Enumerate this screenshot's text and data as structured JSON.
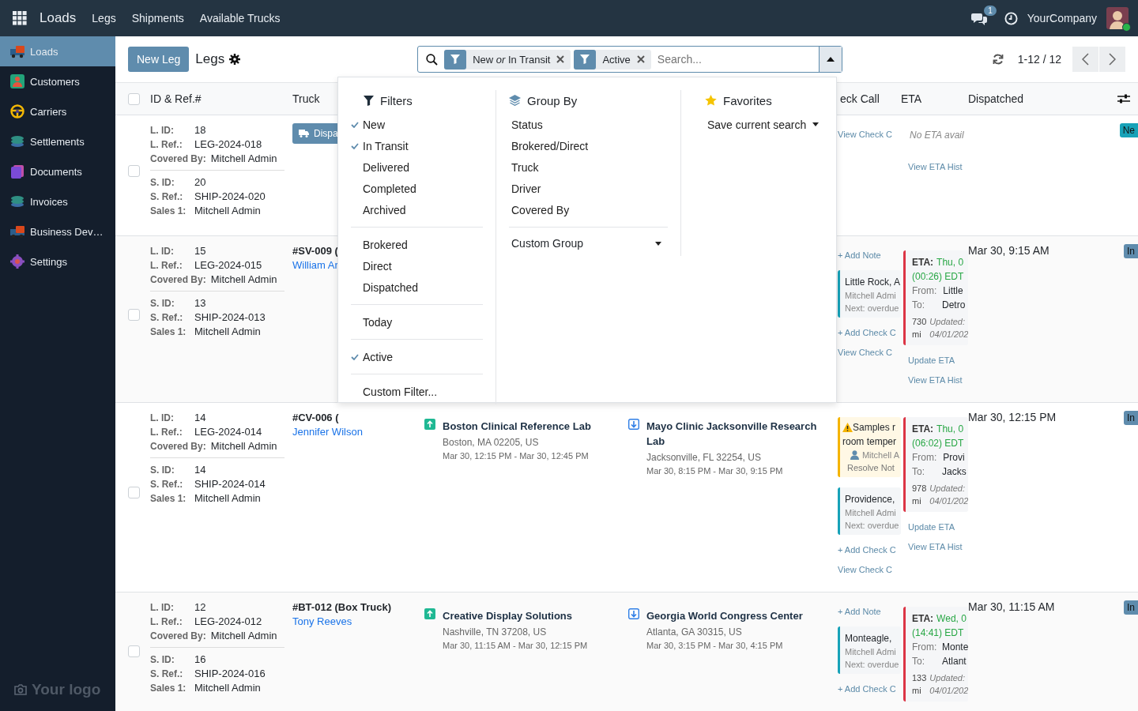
{
  "topbar": {
    "brand": "Loads",
    "menu": [
      "Legs",
      "Shipments",
      "Available Trucks"
    ],
    "messages_count": "1",
    "company": "YourCompany"
  },
  "sidebar": {
    "items": [
      {
        "label": "Loads",
        "selected": true
      },
      {
        "label": "Customers",
        "selected": false
      },
      {
        "label": "Carriers",
        "selected": false
      },
      {
        "label": "Settlements",
        "selected": false
      },
      {
        "label": "Documents",
        "selected": false
      },
      {
        "label": "Invoices",
        "selected": false
      },
      {
        "label": "Business Dev…",
        "selected": false
      },
      {
        "label": "Settings",
        "selected": false
      }
    ],
    "logo": "Your logo"
  },
  "control": {
    "new_button": "New Leg",
    "title": "Legs",
    "facets": [
      {
        "text": "New *or* In Transit"
      },
      {
        "text": "Active"
      }
    ],
    "search_placeholder": "Search...",
    "dropdown_open": true,
    "pager": "1-12 / 12"
  },
  "columns": {
    "select_all": false,
    "id": "ID & Ref.#",
    "truck": "Truck",
    "check_call": "eck Call",
    "eta": "ETA",
    "dispatched": "Dispatched"
  },
  "dropdown": {
    "filters": {
      "title": "Filters",
      "groups": [
        [
          {
            "label": "New",
            "checked": true
          },
          {
            "label": "In Transit",
            "checked": true
          },
          {
            "label": "Delivered",
            "checked": false
          },
          {
            "label": "Completed",
            "checked": false
          },
          {
            "label": "Archived",
            "checked": false
          }
        ],
        [
          {
            "label": "Brokered",
            "checked": false
          },
          {
            "label": "Direct",
            "checked": false
          },
          {
            "label": "Dispatched",
            "checked": false
          }
        ],
        [
          {
            "label": "Today",
            "checked": false
          }
        ],
        [
          {
            "label": "Active",
            "checked": true
          }
        ]
      ],
      "custom": "Custom Filter..."
    },
    "group_by": {
      "title": "Group By",
      "items": [
        "Status",
        "Brokered/Direct",
        "Truck",
        "Driver",
        "Covered By"
      ],
      "custom": "Custom Group"
    },
    "favorites": {
      "title": "Favorites",
      "save": "Save current search"
    }
  },
  "rows": [
    {
      "selected": false,
      "leg_fields": [
        {
          "label": "L. ID:",
          "value": "18"
        },
        {
          "label": "L. Ref.:",
          "value": "LEG-2024-018"
        },
        {
          "label": "Covered By:",
          "value": "Mitchell Admin"
        }
      ],
      "shipment_fields": [
        {
          "label": "S. ID:",
          "value": "20"
        },
        {
          "label": "S. Ref.:",
          "value": "SHIP-2024-020"
        },
        {
          "label": "Sales 1:",
          "value": "Mitchell Admin"
        }
      ],
      "truck": {
        "badge": "Dispa"
      },
      "check_call": [
        {
          "kind": "link",
          "text": "View Check C"
        }
      ],
      "eta": {
        "kind": "none",
        "text": "No ETA avail",
        "links": [
          "View ETA Hist"
        ]
      },
      "status": {
        "kind": "new",
        "label": "Ne"
      }
    },
    {
      "selected": false,
      "leg_fields": [
        {
          "label": "L. ID:",
          "value": "15"
        },
        {
          "label": "L. Ref.:",
          "value": "LEG-2024-015"
        },
        {
          "label": "Covered By:",
          "value": "Mitchell Admin"
        }
      ],
      "shipment_fields": [
        {
          "label": "S. ID:",
          "value": "13"
        },
        {
          "label": "S. Ref.:",
          "value": "SHIP-2024-013"
        },
        {
          "label": "Sales 1:",
          "value": "Mitchell Admin"
        }
      ],
      "truck": {
        "name": "#SV-009 (",
        "driver": "William Ar"
      },
      "check_call": [
        {
          "kind": "link",
          "text": "+ Add Note"
        },
        {
          "kind": "note",
          "title": "Little Rock, A",
          "by": "Mitchell Admi",
          "next": "Next: overdue"
        },
        {
          "kind": "link",
          "text": "+ Add Check C"
        },
        {
          "kind": "link",
          "text": "View Check C"
        }
      ],
      "eta": {
        "kind": "card",
        "label": "ETA:",
        "date": "Thu, 0",
        "time": "(00:26) EDT",
        "from_label": "From:",
        "from": "Little",
        "to_label": "To:",
        "to": "Detro",
        "miles": "730",
        "unit": "mi",
        "updated_label": "Updated:",
        "updated": "04/01/202",
        "links": [
          "Update ETA",
          "View ETA Hist"
        ]
      },
      "dispatched": "Mar 30, 9:15 AM",
      "status": {
        "kind": "transit",
        "label": "In"
      }
    },
    {
      "selected": false,
      "leg_fields": [
        {
          "label": "L. ID:",
          "value": "14"
        },
        {
          "label": "L. Ref.:",
          "value": "LEG-2024-014"
        },
        {
          "label": "Covered By:",
          "value": "Mitchell Admin"
        }
      ],
      "shipment_fields": [
        {
          "label": "S. ID:",
          "value": "14"
        },
        {
          "label": "S. Ref.:",
          "value": "SHIP-2024-014"
        },
        {
          "label": "Sales 1:",
          "value": "Mitchell Admin"
        }
      ],
      "truck": {
        "name": "#CV-006 (",
        "driver": "Jennifer Wilson"
      },
      "pickup": {
        "name": "Boston Clinical Reference Lab",
        "address": "Boston, MA 02205, US",
        "window": "Mar 30, 12:15 PM - Mar 30, 12:45 PM"
      },
      "dropoff": {
        "name": "Mayo Clinic Jacksonville Research Lab",
        "address": "Jacksonville, FL 32254, US",
        "window": "Mar 30, 8:15 PM - Mar 30, 9:15 PM"
      },
      "check_call": [
        {
          "kind": "warning",
          "lines": [
            "Samples r",
            "room temper"
          ],
          "user": "Mitchell A",
          "action": "Resolve Not"
        },
        {
          "kind": "note",
          "title": "Providence,",
          "by": "Mitchell Admi",
          "next": "Next: overdue"
        },
        {
          "kind": "link",
          "text": "+ Add Check C"
        },
        {
          "kind": "link",
          "text": "View Check C"
        }
      ],
      "eta": {
        "kind": "card",
        "label": "ETA:",
        "date": "Thu, 0",
        "time": "(06:02) EDT",
        "from_label": "From:",
        "from": "Provi",
        "to_label": "To:",
        "to": "Jacks",
        "miles": "978",
        "unit": "mi",
        "updated_label": "Updated:",
        "updated": "04/01/202",
        "links": [
          "Update ETA",
          "View ETA Hist"
        ]
      },
      "dispatched": "Mar 30, 12:15 PM",
      "status": {
        "kind": "transit",
        "label": "In"
      }
    },
    {
      "selected": false,
      "leg_fields": [
        {
          "label": "L. ID:",
          "value": "12"
        },
        {
          "label": "L. Ref.:",
          "value": "LEG-2024-012"
        },
        {
          "label": "Covered By:",
          "value": "Mitchell Admin"
        }
      ],
      "shipment_fields": [
        {
          "label": "S. ID:",
          "value": "16"
        },
        {
          "label": "S. Ref.:",
          "value": "SHIP-2024-016"
        },
        {
          "label": "Sales 1:",
          "value": "Mitchell Admin"
        }
      ],
      "truck": {
        "name": "#BT-012 (Box Truck)",
        "driver": "Tony Reeves"
      },
      "pickup": {
        "name": "Creative Display Solutions",
        "address": "Nashville, TN 37208, US",
        "window": "Mar 30, 11:15 AM - Mar 30, 12:15 PM"
      },
      "dropoff": {
        "name": "Georgia World Congress Center",
        "address": "Atlanta, GA 30315, US",
        "window": "Mar 30, 3:15 PM - Mar 30, 4:15 PM"
      },
      "check_call": [
        {
          "kind": "link",
          "text": "+ Add Note"
        },
        {
          "kind": "note",
          "title": "Monteagle,",
          "by": "Mitchell Admi",
          "next": "Next: overdue"
        },
        {
          "kind": "link",
          "text": "+ Add Check C"
        }
      ],
      "eta": {
        "kind": "card",
        "label": "ETA:",
        "date": "Wed, 0",
        "time": "(14:41) EDT",
        "from_label": "From:",
        "from": "Monte",
        "to_label": "To:",
        "to": "Atlant",
        "miles": "133",
        "unit": "mi",
        "updated_label": "Updated:",
        "updated": "04/01/202"
      },
      "dispatched": "Mar 30, 11:15 AM",
      "status": {
        "kind": "transit",
        "label": "In"
      }
    }
  ]
}
